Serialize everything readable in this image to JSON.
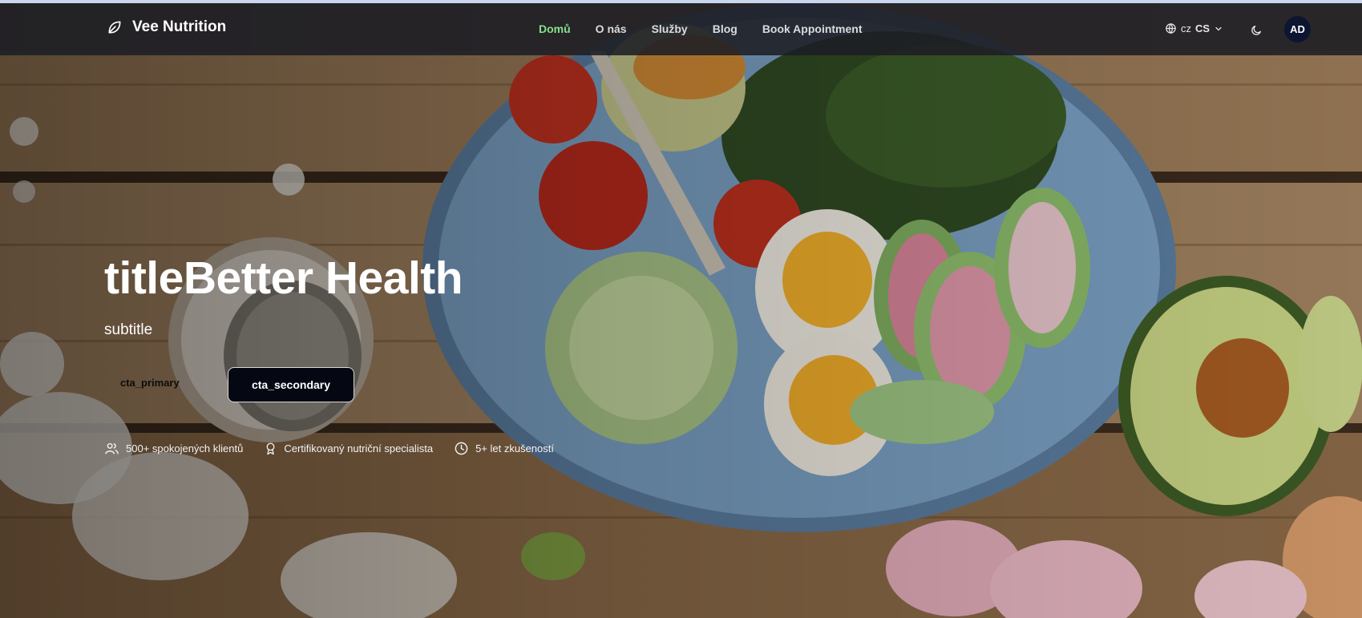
{
  "brand": {
    "name": "Vee Nutrition",
    "icon": "leaf-icon"
  },
  "nav": {
    "items": [
      {
        "label": "Domů",
        "active": true
      },
      {
        "label": "O nás",
        "active": false
      },
      {
        "label": "Služby",
        "active": false
      },
      {
        "label": "Blog",
        "active": false
      },
      {
        "label": "Book Appointment",
        "active": false
      }
    ],
    "language": {
      "flag": "cz",
      "code": "CS",
      "icon": "globe-icon"
    },
    "theme_toggle_icon": "moon-icon",
    "avatar_initials": "AD"
  },
  "hero": {
    "title": "titleBetter Health",
    "subtitle": "subtitle",
    "cta_primary": "cta_primary",
    "cta_secondary": "cta_secondary",
    "features": [
      {
        "icon": "users-icon",
        "text": "500+ spokojených klientů"
      },
      {
        "icon": "award-icon",
        "text": "Certifikovaný nutriční specialista"
      },
      {
        "icon": "clock-icon",
        "text": "5+ let zkušeností"
      }
    ]
  },
  "colors": {
    "accent": "#86e08d",
    "navbar": "#1c1e24",
    "avatar": "#0d1630",
    "secondary_button": "#050812"
  }
}
